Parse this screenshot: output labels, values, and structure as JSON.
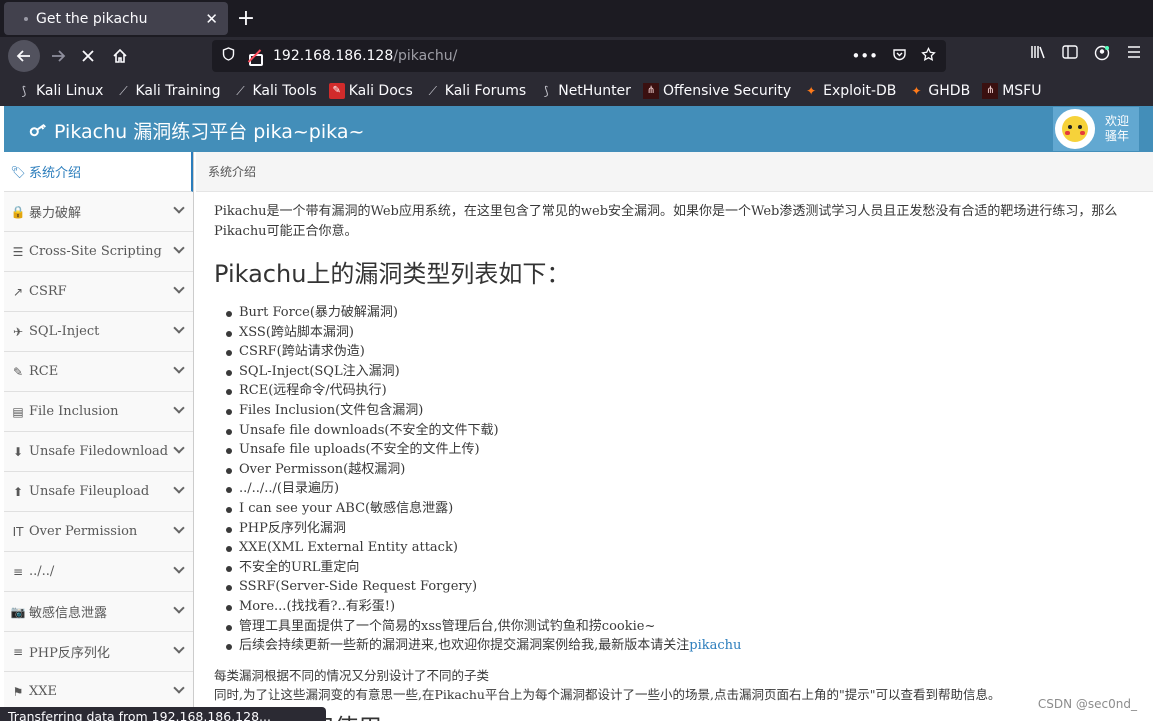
{
  "browser": {
    "tab_title": "Get the pikachu",
    "close_glyph": "✕",
    "new_tab_glyph": "+",
    "url_host": "192.168.186.128",
    "url_path": "/pikachu/",
    "status_text": "Transferring data from 192.168.186.128..."
  },
  "bookmarks": [
    {
      "label": "Kali Linux",
      "icon": "kali-dragon-icon"
    },
    {
      "label": "Kali Training",
      "icon": "kali-dragon-icon"
    },
    {
      "label": "Kali Tools",
      "icon": "kali-dragon-icon"
    },
    {
      "label": "Kali Docs",
      "icon": "kali-docs-icon"
    },
    {
      "label": "Kali Forums",
      "icon": "kali-dragon-icon"
    },
    {
      "label": "NetHunter",
      "icon": "nethunter-icon"
    },
    {
      "label": "Offensive Security",
      "icon": "offsec-icon"
    },
    {
      "label": "Exploit-DB",
      "icon": "exploitdb-icon"
    },
    {
      "label": "GHDB",
      "icon": "ghdb-icon"
    },
    {
      "label": "MSFU",
      "icon": "msfu-icon"
    }
  ],
  "header": {
    "brand": "Pikachu 漏洞练习平台 pika~pika~",
    "user_line1": "欢迎",
    "user_line2": "骚年",
    "color": "#438eb9"
  },
  "sidebar": {
    "items": [
      {
        "label": "系统介绍",
        "icon": "tags-icon"
      },
      {
        "label": "暴力破解",
        "icon": "lock-icon"
      },
      {
        "label": "Cross-Site Scripting",
        "icon": "list-icon"
      },
      {
        "label": "CSRF",
        "icon": "share-icon"
      },
      {
        "label": "SQL-Inject",
        "icon": "fighter-jet-icon"
      },
      {
        "label": "RCE",
        "icon": "pencil-icon"
      },
      {
        "label": "File Inclusion",
        "icon": "file-icon"
      },
      {
        "label": "Unsafe Filedownload",
        "icon": "download-icon"
      },
      {
        "label": "Unsafe Fileupload",
        "icon": "upload-icon"
      },
      {
        "label": "Over Permission",
        "icon": "text-height-icon"
      },
      {
        "label": "../../",
        "icon": "align-icon"
      },
      {
        "label": "敏感信息泄露",
        "icon": "camera-icon"
      },
      {
        "label": "PHP反序列化",
        "icon": "align-icon"
      },
      {
        "label": "XXE",
        "icon": "flag-icon"
      }
    ]
  },
  "breadcrumb": "系统介绍",
  "content": {
    "intro": "Pikachu是一个带有漏洞的Web应用系统，在这里包含了常见的web安全漏洞。如果你是一个Web渗透测试学习人员且正发愁没有合适的靶场进行练习，那么Pikachu可能正合你意。",
    "heading": "Pikachu上的漏洞类型列表如下：",
    "vulns": [
      "Burt Force(暴力破解漏洞)",
      "XSS(跨站脚本漏洞)",
      "CSRF(跨站请求伪造)",
      "SQL-Inject(SQL注入漏洞)",
      "RCE(远程命令/代码执行)",
      "Files Inclusion(文件包含漏洞)",
      "Unsafe file downloads(不安全的文件下载)",
      "Unsafe file uploads(不安全的文件上传)",
      "Over Permisson(越权漏洞)",
      "../../../(目录遍历)",
      "I can see your ABC(敏感信息泄露)",
      "PHP反序列化漏洞",
      "XXE(XML External Entity attack)",
      "不安全的URL重定向",
      "SSRF(Server-Side Request Forgery)",
      "More...(找找看?..有彩蛋!)",
      "管理工具里面提供了一个简易的xss管理后台,供你测试钓鱼和捞cookie~"
    ],
    "last_item_text": "后续会持续更新一些新的漏洞进来,也欢迎你提交漏洞案例给我,最新版本请关注",
    "last_item_link": "pikachu",
    "note1": "每类漏洞根据不同的情况又分别设计了不同的子类",
    "note2": "同时,为了让这些漏洞变的有意思一些,在Pikachu平台上为每个漏洞都设计了一些小的场景,点击漏洞页面右上角的\"提示\"可以查看到帮助信息。",
    "subhead": "如何安装和使用"
  },
  "watermark": "CSDN @sec0nd_"
}
